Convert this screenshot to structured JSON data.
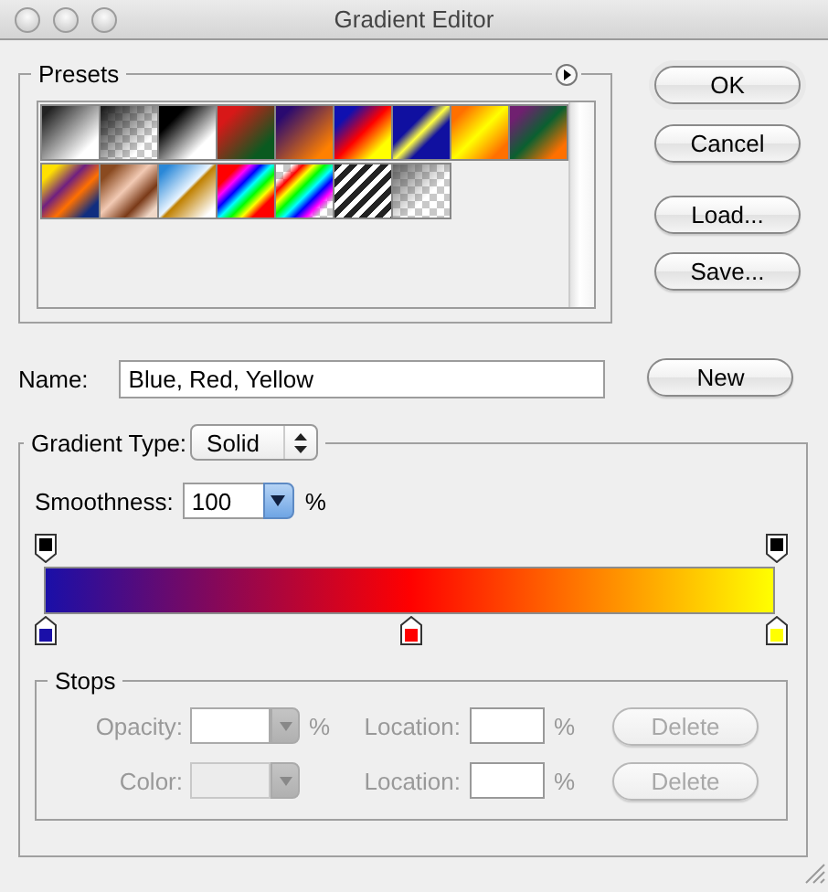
{
  "window": {
    "title": "Gradient Editor"
  },
  "presets": {
    "title": "Presets"
  },
  "buttons": [
    {
      "label": "OK",
      "kind": "default"
    },
    {
      "label": "Cancel",
      "kind": "plain"
    },
    {
      "label": "Load...",
      "kind": "plain"
    },
    {
      "label": "Save...",
      "kind": "plain"
    }
  ],
  "name": {
    "label": "Name:",
    "value": "Blue, Red, Yellow",
    "button": "New"
  },
  "gradient_type": {
    "label": "Gradient Type:",
    "value": "Solid"
  },
  "smoothness": {
    "label": "Smoothness:",
    "value": "100",
    "unit": "%"
  },
  "opacity_stops": [
    {
      "color": "#000000"
    },
    {
      "color": "#000000"
    }
  ],
  "color_stops": [
    {
      "color": "#1a0fa8"
    },
    {
      "color": "#ff0000"
    },
    {
      "color": "#ffff00"
    }
  ],
  "stops": {
    "title": "Stops",
    "rows": [
      {
        "kind": "opacity",
        "label": "Opacity:",
        "unit": "%",
        "location_label": "Location:",
        "location_unit": "%",
        "button": "Delete",
        "disabled": true
      },
      {
        "kind": "color",
        "label": "Color:",
        "location_label": "Location:",
        "location_unit": "%",
        "button": "Delete",
        "disabled": true
      }
    ]
  }
}
